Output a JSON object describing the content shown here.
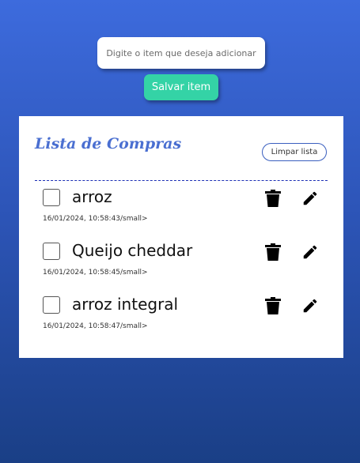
{
  "form": {
    "input_placeholder": "Digite o item que deseja adicionar",
    "input_value": "",
    "save_label": "Salvar item"
  },
  "list": {
    "title": "Lista de Compras",
    "clear_label": "Limpar lista",
    "items": [
      {
        "name": "arroz",
        "date": "16/01/2024, 10:58:43/small>",
        "checked": false
      },
      {
        "name": "Queijo cheddar",
        "date": "16/01/2024, 10:58:45/small>",
        "checked": false
      },
      {
        "name": "arroz integral",
        "date": "16/01/2024, 10:58:47/small>",
        "checked": false
      }
    ]
  },
  "colors": {
    "accent_button": "#34d3a6",
    "title": "#4a6fd1",
    "background_top": "#3d6bdd",
    "background_bottom": "#1a3f86"
  },
  "icons": {
    "delete": "trash-icon",
    "edit": "pencil-icon"
  }
}
